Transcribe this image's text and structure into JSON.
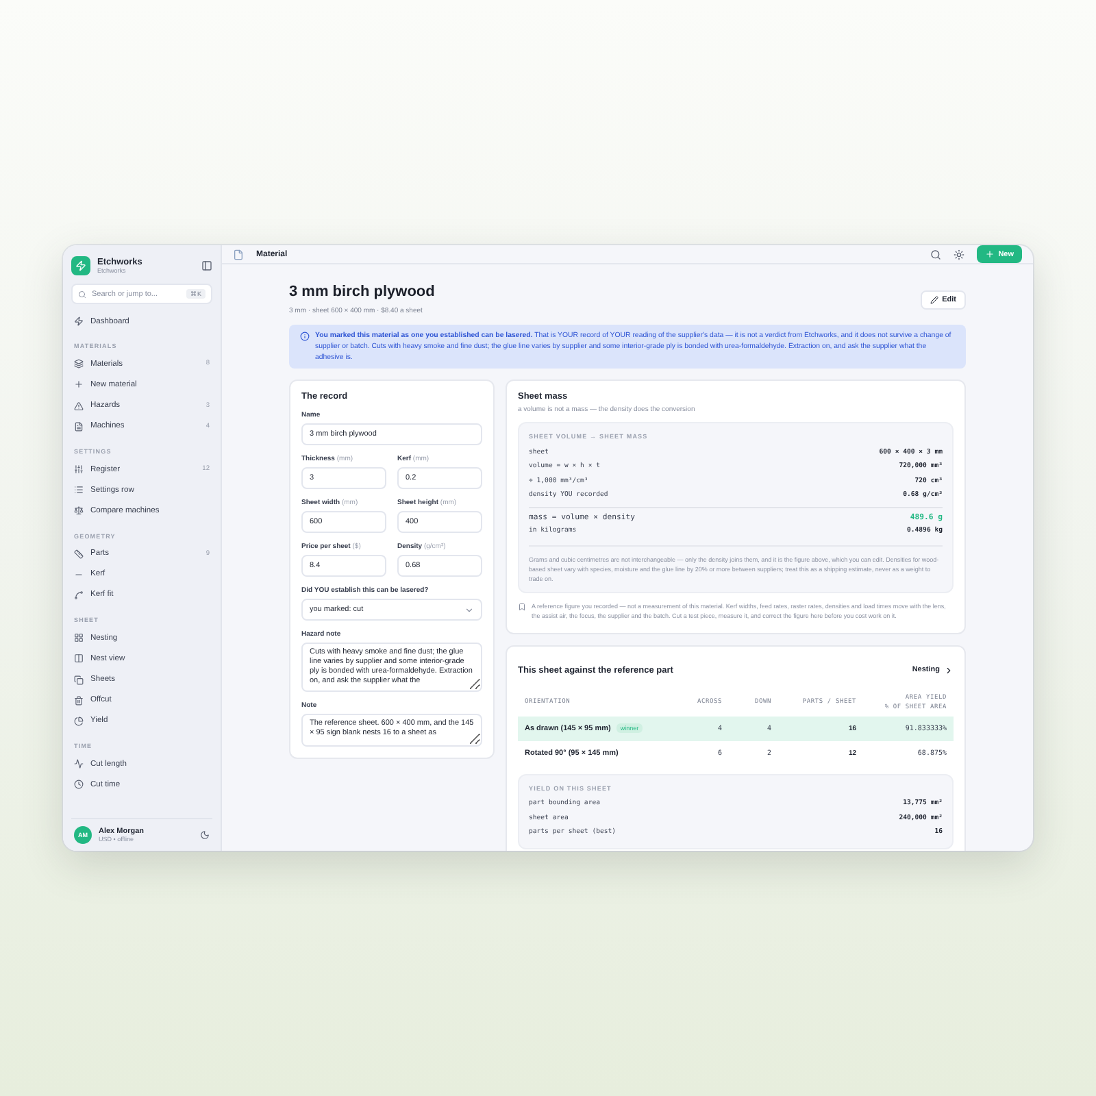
{
  "app": {
    "name": "Etchworks",
    "subtitle": "Etchworks"
  },
  "search": {
    "placeholder": "Search or jump to...",
    "shortcut": "⌘K"
  },
  "sidebar": {
    "sections": [
      {
        "items": [
          {
            "label": "Dashboard"
          }
        ]
      },
      {
        "heading": "MATERIALS",
        "items": [
          {
            "label": "Materials",
            "count": "8"
          },
          {
            "label": "New material"
          },
          {
            "label": "Hazards",
            "count": "3"
          },
          {
            "label": "Machines",
            "count": "4"
          }
        ]
      },
      {
        "heading": "SETTINGS",
        "items": [
          {
            "label": "Register",
            "count": "12"
          },
          {
            "label": "Settings row"
          },
          {
            "label": "Compare machines"
          }
        ]
      },
      {
        "heading": "GEOMETRY",
        "items": [
          {
            "label": "Parts",
            "count": "9"
          },
          {
            "label": "Kerf"
          },
          {
            "label": "Kerf fit"
          }
        ]
      },
      {
        "heading": "SHEET",
        "items": [
          {
            "label": "Nesting"
          },
          {
            "label": "Nest view"
          },
          {
            "label": "Sheets"
          },
          {
            "label": "Offcut"
          },
          {
            "label": "Yield"
          }
        ]
      },
      {
        "heading": "TIME",
        "items": [
          {
            "label": "Cut length"
          },
          {
            "label": "Cut time"
          }
        ]
      }
    ]
  },
  "user": {
    "initials": "AM",
    "name": "Alex Morgan",
    "status": "USD • offline"
  },
  "topbar": {
    "title": "Material",
    "new_button": "New"
  },
  "page": {
    "title": "3 mm birch plywood",
    "subtitle": "3 mm · sheet 600 × 400 mm · $8.40 a sheet",
    "edit_button": "Edit"
  },
  "banner": "**You marked this material as one you established can be lasered.** That is YOUR record of YOUR reading of the supplier's data — it is not a verdict from Etchworks, and it does not survive a change of supplier or batch. Cuts with heavy smoke and fine dust; the glue line varies by supplier and some interior-grade ply is bonded with urea-formaldehyde. Extraction on, and ask the supplier what the adhesive is.",
  "record": {
    "title": "The record",
    "rows": [
      [
        {
          "kind": "input",
          "label": "Name",
          "value": "3 mm birch plywood"
        }
      ],
      [
        {
          "kind": "input",
          "label": "Thickness",
          "unit": "(mm)",
          "value": "3"
        },
        {
          "kind": "input",
          "label": "Kerf",
          "unit": "(mm)",
          "value": "0.2"
        }
      ],
      [
        {
          "kind": "input",
          "label": "Sheet width",
          "unit": "(mm)",
          "value": "600"
        },
        {
          "kind": "input",
          "label": "Sheet height",
          "unit": "(mm)",
          "value": "400"
        }
      ],
      [
        {
          "kind": "input",
          "label": "Price per sheet",
          "unit": "($)",
          "value": "8.4"
        },
        {
          "kind": "input",
          "label": "Density",
          "unit": "(g/cm³)",
          "value": "0.68"
        }
      ],
      [
        {
          "kind": "select",
          "label": "Did YOU establish this can be lasered?",
          "value": "you marked: cut"
        }
      ],
      [
        {
          "kind": "textarea",
          "label": "Hazard note",
          "value": "Cuts with heavy smoke and fine dust; the glue line varies by supplier and some interior-grade ply is bonded with urea-formaldehyde. Extraction on, and ask the supplier what the"
        }
      ],
      [
        {
          "kind": "textarea",
          "label": "Note",
          "value": "The reference sheet. 600 × 400 mm, and the 145 × 95 sign blank nests 16 to a sheet as"
        }
      ]
    ]
  },
  "mass": {
    "title": "Sheet mass",
    "subtitle": "a volume is not a mass — the density does the conversion",
    "heading": "SHEET VOLUME → SHEET MASS",
    "rows": [
      {
        "kind": "step",
        "label": "sheet",
        "value": "600 × 400 × 3 mm"
      },
      {
        "kind": "step",
        "label": "volume = w × h × t",
        "value": "720,000 mm³"
      },
      {
        "kind": "step",
        "label": "÷ 1,000 mm³/cm³",
        "value": "720 cm³"
      },
      {
        "kind": "step",
        "label": "density YOU recorded",
        "value": "0.68 g/cm³"
      },
      {
        "kind": "result",
        "label": "mass = volume × density",
        "value": "489.6 g"
      },
      {
        "kind": "step",
        "label": "in kilograms",
        "value": "0.4896 kg"
      }
    ],
    "explanation": "Grams and cubic centimetres are not interchangeable — only the density joins them, and it is the figure above, which you can edit. Densities for wood-based sheet vary with species, moisture and the glue line by 20% or more between suppliers; treat this as a shipping estimate, never as a weight to trade on.",
    "footnote": "A reference figure you recorded — not a measurement of this material. Kerf widths, feed rates, raster rates, densities and load times move with the lens, the assist air, the focus, the supplier and the batch. Cut a test piece, measure it, and correct the figure here before you cost work on it."
  },
  "nesting": {
    "title": "This sheet against the reference part",
    "link": "Nesting",
    "columns": [
      {
        "label": "ORIENTATION"
      },
      {
        "label": "ACROSS"
      },
      {
        "label": "DOWN"
      },
      {
        "label": "PARTS / SHEET"
      },
      {
        "label": "AREA YIELD",
        "sublabel": "% OF SHEET AREA"
      }
    ],
    "rows": [
      {
        "orientation": "As drawn (145 × 95 mm)",
        "badge": "winner",
        "across": "4",
        "down": "4",
        "parts": "16",
        "yield": "91.833333%",
        "selected": true
      },
      {
        "orientation": "Rotated 90° (95 × 145 mm)",
        "across": "6",
        "down": "2",
        "parts": "12",
        "yield": "68.875%",
        "selected": false
      }
    ],
    "yield": {
      "heading": "YIELD ON THIS SHEET",
      "rows": [
        {
          "label": "part bounding area",
          "value": "13,775 mm²"
        },
        {
          "label": "sheet area",
          "value": "240,000 mm²"
        },
        {
          "label": "parts per sheet (best)",
          "value": "16"
        }
      ]
    }
  }
}
